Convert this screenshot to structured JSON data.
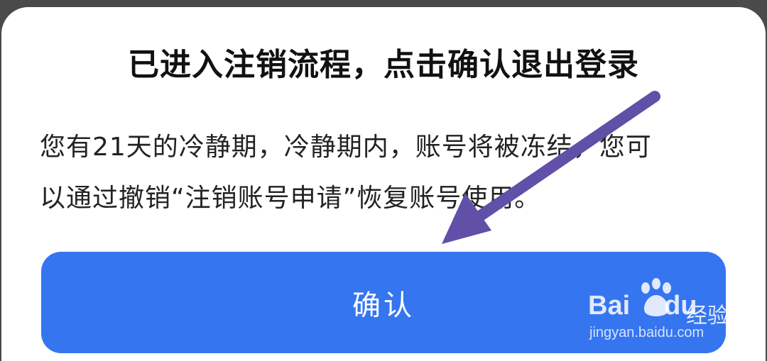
{
  "dialog": {
    "title": "已进入注销流程，点击确认退出登录",
    "message_line1": "您有21天的冷静期，冷静期内，账号将被冻结，您可",
    "message_line2": "以通过撤销“注销账号申请”恢复账号使用。",
    "confirm_label": "确认"
  },
  "annotation": {
    "arrow_color": "#6050a8"
  },
  "watermark": {
    "brand_left": "Bai",
    "brand_right": "du",
    "brand_cn": "经验",
    "url": "jingyan.baidu.com"
  },
  "colors": {
    "backdrop": "#4a4a4a",
    "dialog_bg": "#ffffff",
    "button_bg": "#3575f0",
    "button_text": "#ffffff"
  }
}
